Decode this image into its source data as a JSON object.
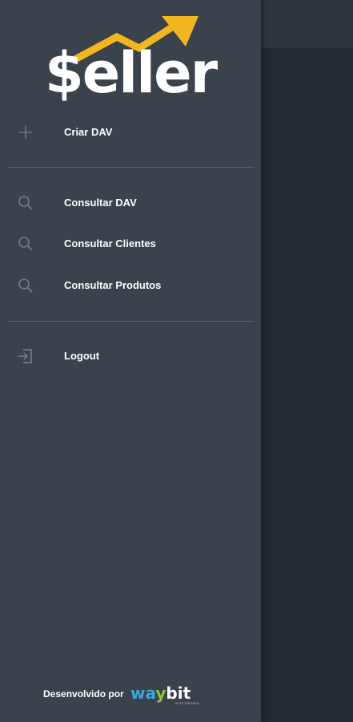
{
  "app": {
    "logo_text": "$eller",
    "accent_color": "#f2b61e"
  },
  "menu": {
    "items": [
      {
        "label": "Criar DAV",
        "icon": "plus-icon"
      },
      {
        "label": "Consultar DAV",
        "icon": "search-icon"
      },
      {
        "label": "Consultar Clientes",
        "icon": "search-icon"
      },
      {
        "label": "Consultar Produtos",
        "icon": "search-icon"
      },
      {
        "label": "Logout",
        "icon": "logout-icon"
      }
    ]
  },
  "footer": {
    "developed_by": "Desenvolvido por",
    "brand_parts": [
      "w",
      "a",
      "y",
      "bit"
    ],
    "brand_sub": "SOFTWARE"
  }
}
